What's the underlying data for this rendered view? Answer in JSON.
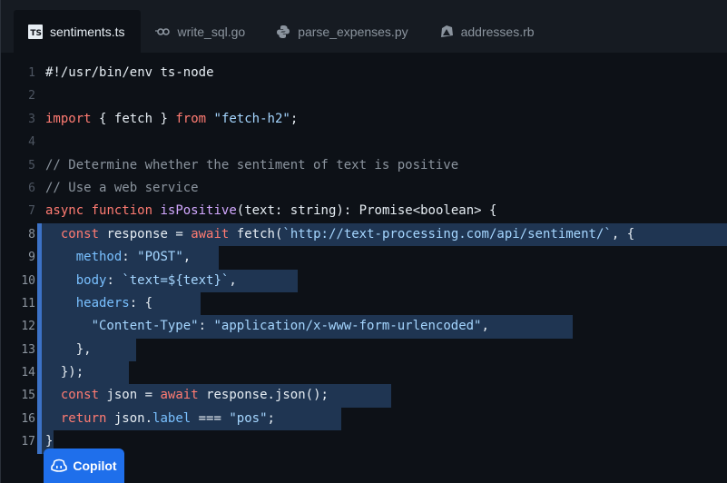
{
  "tabs": [
    {
      "label": "sentiments.ts",
      "icon": "typescript-icon",
      "active": true
    },
    {
      "label": "write_sql.go",
      "icon": "go-icon",
      "active": false
    },
    {
      "label": "parse_expenses.py",
      "icon": "python-icon",
      "active": false
    },
    {
      "label": "addresses.rb",
      "icon": "ruby-icon",
      "active": false
    }
  ],
  "ts_badge": "TS",
  "lines": [
    {
      "n": "1",
      "text": "#!/usr/bin/env ts-node"
    },
    {
      "n": "2",
      "text": ""
    },
    {
      "n": "3",
      "text": "import { fetch } from \"fetch-h2\";"
    },
    {
      "n": "4",
      "text": ""
    },
    {
      "n": "5",
      "text": "// Determine whether the sentiment of text is positive"
    },
    {
      "n": "6",
      "text": "// Use a web service"
    },
    {
      "n": "7",
      "text": "async function isPositive(text: string): Promise<boolean> {"
    },
    {
      "n": "8",
      "text": "  const response = await fetch(`http://text-processing.com/api/sentiment/`, {"
    },
    {
      "n": "9",
      "text": "    method: \"POST\","
    },
    {
      "n": "10",
      "text": "    body: `text=${text}`,"
    },
    {
      "n": "11",
      "text": "    headers: {"
    },
    {
      "n": "12",
      "text": "      \"Content-Type\": \"application/x-www-form-urlencoded\","
    },
    {
      "n": "13",
      "text": "    },"
    },
    {
      "n": "14",
      "text": "  });"
    },
    {
      "n": "15",
      "text": "  const json = await response.json();"
    },
    {
      "n": "16",
      "text": "  return json.label === \"pos\";"
    },
    {
      "n": "17",
      "text": "}"
    }
  ],
  "suggestion_lines": [
    "8",
    "9",
    "10",
    "11",
    "12",
    "13",
    "14",
    "15",
    "16",
    "17"
  ],
  "copilot": {
    "label": "Copilot",
    "icon": "copilot-icon"
  },
  "colors": {
    "background": "#0d1117",
    "keyword": "#ff7b72",
    "function": "#d2a8ff",
    "string": "#a5d6ff",
    "comment": "#8b949e",
    "property": "#79c0ff",
    "selection": "#1f3552",
    "copilot_button": "#1f6feb"
  }
}
